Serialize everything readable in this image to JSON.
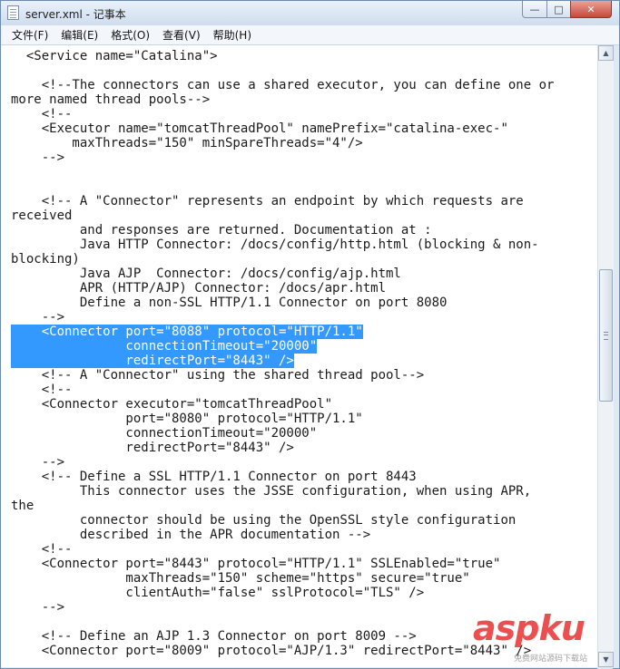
{
  "window": {
    "title": "server.xml - 记事本",
    "controls": {
      "minimize": "—",
      "maximize": "□",
      "close": "✕"
    }
  },
  "menu": {
    "items": [
      "文件(F)",
      "编辑(E)",
      "格式(O)",
      "查看(V)",
      "帮助(H)"
    ]
  },
  "editor": {
    "lines": [
      "  <Service name=\"Catalina\">",
      "",
      "    <!--The connectors can use a shared executor, you can define one or",
      "more named thread pools-->",
      "    <!--",
      "    <Executor name=\"tomcatThreadPool\" namePrefix=\"catalina-exec-\"",
      "        maxThreads=\"150\" minSpareThreads=\"4\"/>",
      "    -->",
      "",
      "",
      "    <!-- A \"Connector\" represents an endpoint by which requests are",
      "received",
      "         and responses are returned. Documentation at :",
      "         Java HTTP Connector: /docs/config/http.html (blocking & non-",
      "blocking)",
      "         Java AJP  Connector: /docs/config/ajp.html",
      "         APR (HTTP/AJP) Connector: /docs/apr.html",
      "         Define a non-SSL HTTP/1.1 Connector on port 8080",
      "    -->",
      "    <Connector port=\"8088\" protocol=\"HTTP/1.1\"",
      "               connectionTimeout=\"20000\"",
      "               redirectPort=\"8443\" />",
      "    <!-- A \"Connector\" using the shared thread pool-->",
      "    <!--",
      "    <Connector executor=\"tomcatThreadPool\"",
      "               port=\"8080\" protocol=\"HTTP/1.1\"",
      "               connectionTimeout=\"20000\"",
      "               redirectPort=\"8443\" />",
      "    -->",
      "    <!-- Define a SSL HTTP/1.1 Connector on port 8443",
      "         This connector uses the JSSE configuration, when using APR,",
      "the",
      "         connector should be using the OpenSSL style configuration",
      "         described in the APR documentation -->",
      "    <!--",
      "    <Connector port=\"8443\" protocol=\"HTTP/1.1\" SSLEnabled=\"true\"",
      "               maxThreads=\"150\" scheme=\"https\" secure=\"true\"",
      "               clientAuth=\"false\" sslProtocol=\"TLS\" />",
      "    -->",
      "",
      "    <!-- Define an AJP 1.3 Connector on port 8009 -->",
      "    <Connector port=\"8009\" protocol=\"AJP/1.3\" redirectPort=\"8443\" />"
    ],
    "selected_lines": [
      19,
      20,
      21
    ]
  },
  "watermark": {
    "text": "aspku",
    "subtext": "免费网站源码下载站"
  },
  "colors": {
    "selection": "#3399ff",
    "close_button": "#c8473a",
    "watermark": "#e61e1e"
  }
}
